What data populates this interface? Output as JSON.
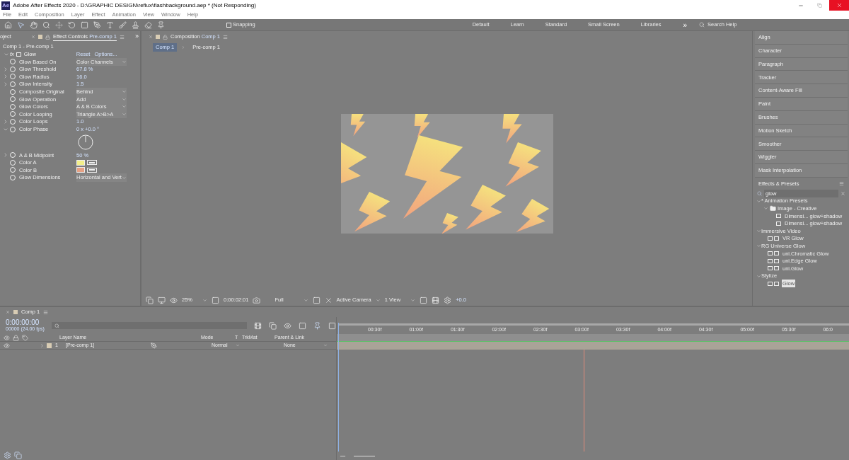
{
  "title_bar": {
    "title": "Adobe After Effects 2020 - D:\\GRAPHIC DESIGN\\reflux\\flashbackground.aep * (Not Responding)",
    "app_badge": "Ae"
  },
  "menu": [
    "File",
    "Edit",
    "Composition",
    "Layer",
    "Effect",
    "Animation",
    "View",
    "Window",
    "Help"
  ],
  "toolbar": {
    "snapping": {
      "label": "Snapping",
      "checked": false
    }
  },
  "workspaces": [
    "Default",
    "Learn",
    "Standard",
    "Small Screen",
    "Libraries"
  ],
  "more": "»",
  "search_help": {
    "placeholder": "Search Help"
  },
  "left_panel": {
    "cut_tab": "oject",
    "tab": "Effect Controls",
    "tab_target": "Pre-comp 1",
    "more": "»",
    "breadcrumb": "Comp 1 - Pre-comp 1",
    "effect": {
      "badge": "fx",
      "name": "Glow",
      "reset": "Reset",
      "options": "Options...",
      "expanded": true
    },
    "properties": [
      {
        "kind": "dropdown",
        "name": "Glow Based On",
        "value": "Color Channels"
      },
      {
        "kind": "number",
        "name": "Glow Threshold",
        "value": "67.8 %",
        "expanded": false
      },
      {
        "kind": "number",
        "name": "Glow Radius",
        "value": "16.0",
        "expanded": false
      },
      {
        "kind": "number",
        "name": "Glow Intensity",
        "value": "1.5",
        "expanded": false
      },
      {
        "kind": "dropdown",
        "name": "Composite Original",
        "value": "Behind"
      },
      {
        "kind": "dropdown",
        "name": "Glow Operation",
        "value": "Add"
      },
      {
        "kind": "dropdown",
        "name": "Glow Colors",
        "value": "A & B Colors"
      },
      {
        "kind": "dropdown",
        "name": "Color Looping",
        "value": "Triangle A>B>A"
      },
      {
        "kind": "number",
        "name": "Color Loops",
        "value": "1.0",
        "expanded": false
      },
      {
        "kind": "angle",
        "name": "Color Phase",
        "value": "0 x +0.0 °",
        "expanded": true
      },
      {
        "kind": "number",
        "name": "A & B Midpoint",
        "value": "50 %",
        "expanded": false
      },
      {
        "kind": "color",
        "name": "Color A",
        "color": "#f3ef8a"
      },
      {
        "kind": "color",
        "name": "Color B",
        "color": "#e6a184"
      },
      {
        "kind": "dropdown",
        "name": "Glow Dimensions",
        "value": "Horizontal and Vert"
      }
    ]
  },
  "composition": {
    "tab": "Composition",
    "tab_target": "Comp 1",
    "breadcrumbs": [
      {
        "label": "Comp 1",
        "selected": true
      },
      {
        "label": "Pre-comp 1",
        "selected": false
      }
    ],
    "bottom_bar": {
      "zoom": "25%",
      "timecode": "0:00:02:01",
      "resolution": "Full",
      "camera": "Active Camera",
      "views": "1 View",
      "exposure": "+0.0"
    }
  },
  "right_panel": {
    "items": [
      "Align",
      "Character",
      "Paragraph",
      "Tracker",
      "Content-Aware Fill",
      "Paint",
      "Brushes",
      "Motion Sketch",
      "Smoother",
      "Wiggler",
      "Mask Interpolation"
    ],
    "effects_presets": {
      "title": "Effects & Presets",
      "search": "glow",
      "tree": [
        {
          "kind": "category",
          "label": "* Animation Presets",
          "expanded": true,
          "children": [
            {
              "kind": "folder",
              "label": "Image - Creative",
              "expanded": true,
              "children": [
                {
                  "kind": "preset",
                  "label": "Dimensi... glow+shadow",
                  "selected": false
                },
                {
                  "kind": "preset",
                  "label": "Dimensi... glow+shadow",
                  "selected": false
                }
              ]
            }
          ]
        },
        {
          "kind": "category",
          "label": "Immersive Video",
          "expanded": true,
          "children": [
            {
              "kind": "effect",
              "label": "VR Glow",
              "selected": false
            }
          ]
        },
        {
          "kind": "category",
          "label": "RG Universe Glow",
          "expanded": true,
          "children": [
            {
              "kind": "effect",
              "label": "uni.Chromatic Glow",
              "selected": false
            },
            {
              "kind": "effect",
              "label": "uni.Edge Glow",
              "selected": false
            },
            {
              "kind": "effect",
              "label": "uni.Glow",
              "selected": false
            }
          ]
        },
        {
          "kind": "category",
          "label": "Stylize",
          "expanded": true,
          "children": [
            {
              "kind": "effect",
              "label": "Glow",
              "selected": true
            }
          ]
        }
      ]
    }
  },
  "timeline": {
    "tab": "Comp 1",
    "timecode": "0:00:00:00",
    "fps": "00000 (24.00 fps)",
    "columns": {
      "layer_name": "Layer Name",
      "mode": "Mode",
      "t": "T",
      "trkmat": "TrkMat",
      "parent": "Parent & Link"
    },
    "layers": [
      {
        "number": "1",
        "name": "[Pre-comp 1]",
        "mode": "Normal",
        "parent": "None",
        "expanded": false
      }
    ],
    "ruler": [
      "00:30f",
      "01:00f",
      "01:30f",
      "02:00f",
      "02:30f",
      "03:00f",
      "03:30f",
      "04:00f",
      "04:30f",
      "05:00f",
      "05:30f",
      "06:0"
    ]
  }
}
